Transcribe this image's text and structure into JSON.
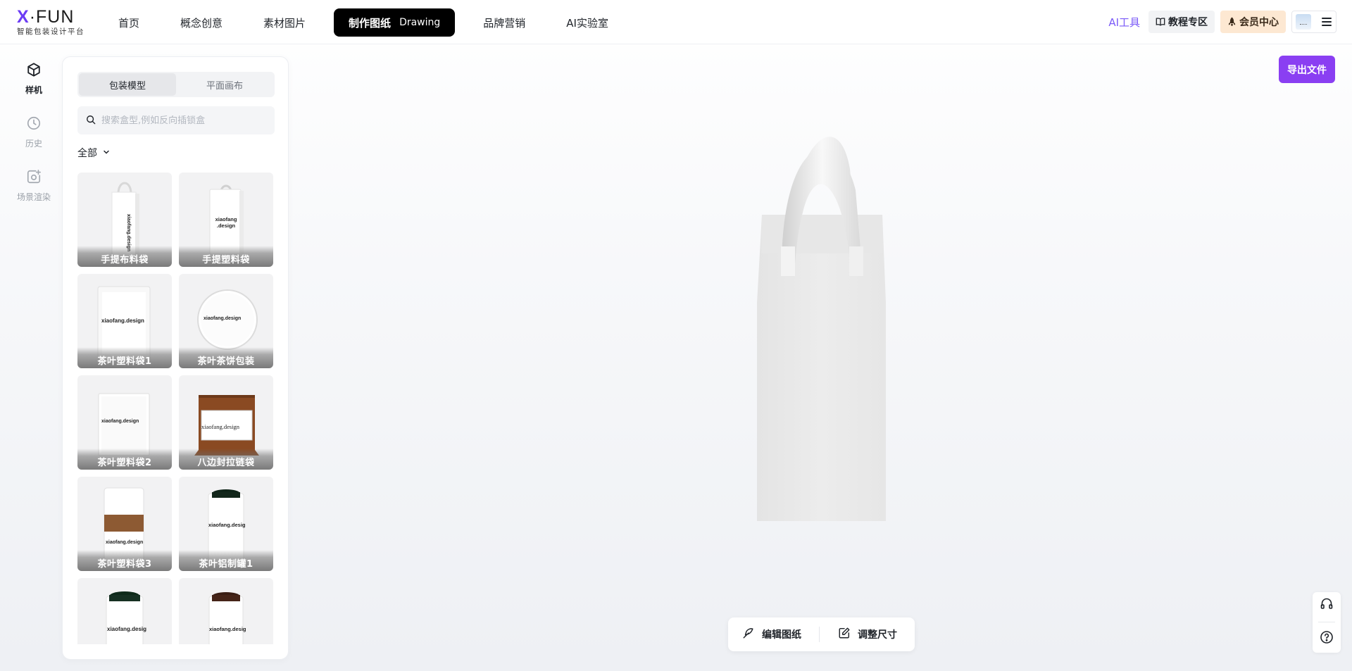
{
  "brand": {
    "logo_x": "X",
    "logo_dot": "·",
    "logo_fun": "FUN",
    "tagline": "智能包装设计平台"
  },
  "nav": {
    "home": "首页",
    "concept": "概念创意",
    "assets": "素材图片",
    "drawing_cn": "制作图纸",
    "drawing_en": "Drawing",
    "brand_marketing": "品牌营销",
    "ai_lab": "AI实验室"
  },
  "header_right": {
    "ai_tools": "AI工具",
    "tutorial": "教程专区",
    "member": "会员中心"
  },
  "rail": {
    "mockup": "样机",
    "history": "历史",
    "scene_render": "场景渲染"
  },
  "library": {
    "tab_model": "包装模型",
    "tab_flat": "平面画布",
    "search_placeholder": "搜索盒型,例如反向插锁盒",
    "filter_label": "全部",
    "items": [
      {
        "label": "手提布料袋",
        "logo": "xiaofang.design"
      },
      {
        "label": "手提塑料袋",
        "logo": "xiaofang .design"
      },
      {
        "label": "茶叶塑料袋1",
        "logo": "xiaofang.design"
      },
      {
        "label": "茶叶茶饼包装",
        "logo": "xiaofang.design"
      },
      {
        "label": "茶叶塑料袋2",
        "logo": "xiaofang.design"
      },
      {
        "label": "八边封拉链袋",
        "logo": "xiaofang.design"
      },
      {
        "label": "茶叶塑料袋3",
        "logo": "xiaofang.design"
      },
      {
        "label": "茶叶铝制罐1",
        "logo": "xiaofang.desig"
      },
      {
        "label": "",
        "logo": "xiaofang.desig"
      },
      {
        "label": "",
        "logo": "xiaofang.desig"
      }
    ]
  },
  "canvas": {
    "export": "导出文件",
    "edit_drawing": "编辑图纸",
    "adjust_size": "调整尺寸"
  },
  "colors": {
    "accent": "#8a3ff2",
    "brand_purple": "#6c3cf5",
    "ai_tools": "#7a5af8",
    "member_bg": "#fde8d2",
    "active_nav_bg": "#000000"
  },
  "icons": {
    "mockup": "cube-icon",
    "history": "clock-icon",
    "scene": "camera-plus-icon",
    "search": "search-icon",
    "filter": "chevron-down-icon",
    "tutorial": "book-icon",
    "member": "rocket-icon",
    "menu": "hamburger-icon",
    "edit": "feather-pen-icon",
    "resize": "edit-square-icon",
    "support": "headset-icon",
    "help": "question-circle-icon"
  }
}
